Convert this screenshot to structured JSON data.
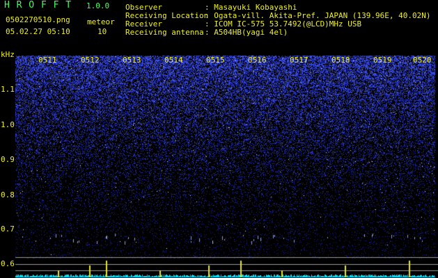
{
  "app": {
    "name": "H R O F F T",
    "version": "1.0.0",
    "filename": "0502270510.png",
    "datetime": "05.02.27 05:10"
  },
  "meteor": {
    "label": "meteor",
    "count": "10"
  },
  "info": [
    {
      "label": "Observer",
      "value": ": Masayuki Kobayashi"
    },
    {
      "label": "Receiving Location",
      "value": ": Ogata-vill. Akita-Pref. JAPAN (139.96E, 40.02N)"
    },
    {
      "label": "Receiver",
      "value": ": ICOM IC-575 53.7492(@LCD)MHz USB"
    },
    {
      "label": "Receiving antenna",
      "value": ": A504HB(yagi 4el)"
    }
  ],
  "spectrogram": {
    "y_unit": "kHz",
    "y_ticks": [
      "1.1",
      "1.0",
      "0.9",
      "0.8",
      "0.7",
      "0.6"
    ],
    "time_labels": [
      "0511",
      "0512",
      "0513",
      "0514",
      "0515",
      "0516",
      "0517",
      "0518",
      "0519",
      "0520"
    ],
    "colors": {
      "background": "#000000",
      "noise": "#3c44ff",
      "text": "#f0f020",
      "title": "#40ff60",
      "signal": "#00ffff"
    }
  }
}
